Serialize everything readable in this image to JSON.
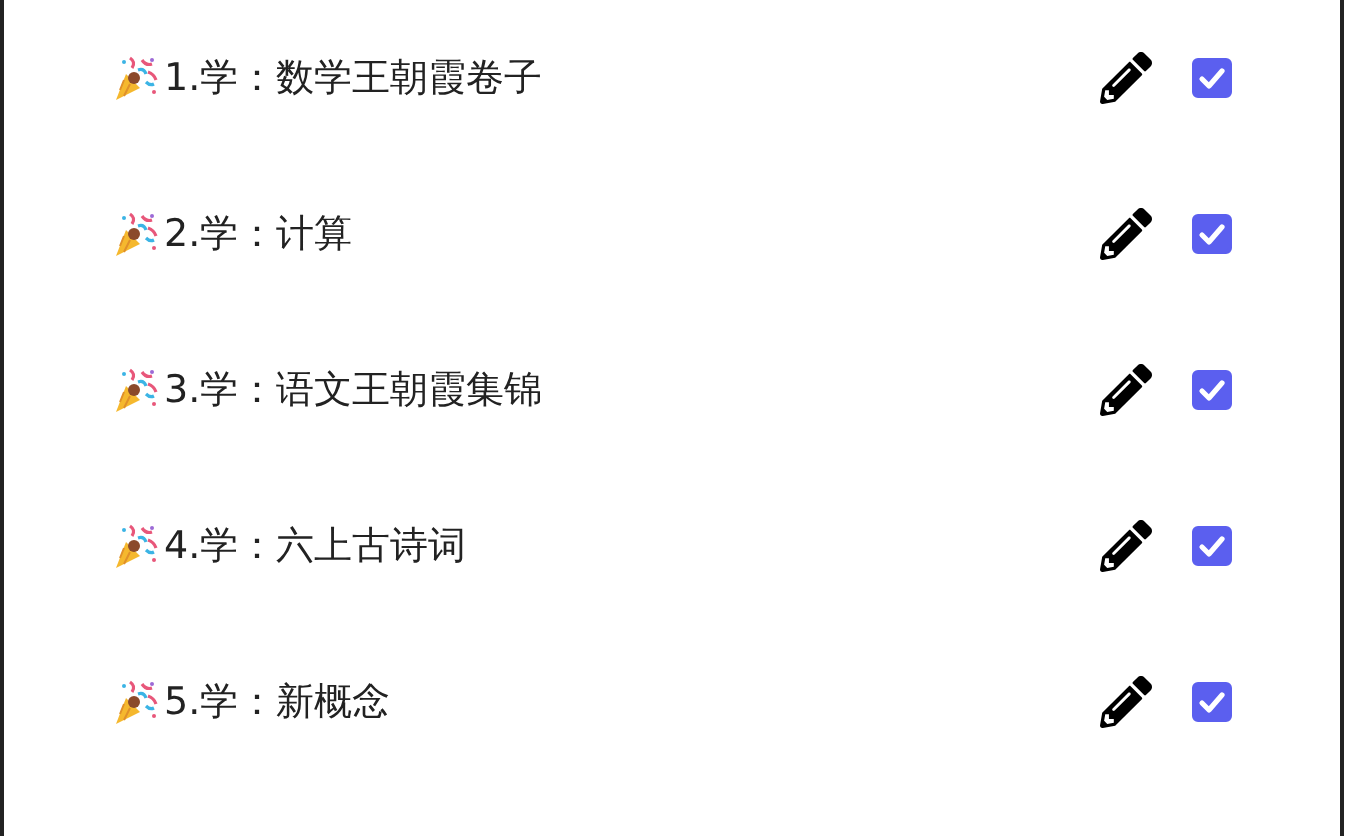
{
  "tasks": [
    {
      "label": "1.学：数学王朝霞卷子",
      "checked": true
    },
    {
      "label": "2.学：计算",
      "checked": true
    },
    {
      "label": "3.学：语文王朝霞集锦",
      "checked": true
    },
    {
      "label": "4.学：六上古诗词",
      "checked": true
    },
    {
      "label": "5.学：新概念",
      "checked": true
    }
  ]
}
